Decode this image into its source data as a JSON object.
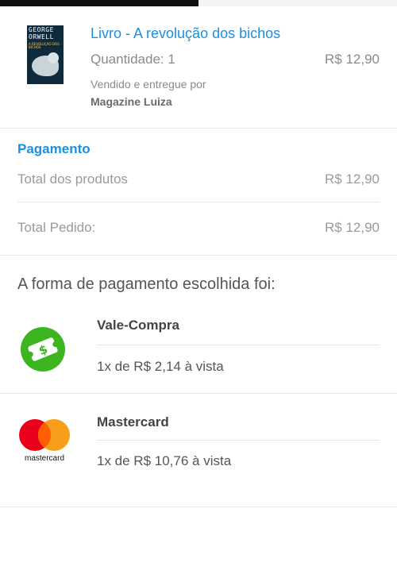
{
  "product": {
    "cover_line1": "GEORGE",
    "cover_line2": "ORWELL",
    "cover_line3": "A REVOLUÇÃO DOS BICHOS",
    "title": "Livro - A revolução dos bichos",
    "quantity": "Quantidade: 1",
    "price": "R$ 12,90",
    "sold_by": "Vendido e entregue por",
    "seller": "Magazine Luiza"
  },
  "payment": {
    "title": "Pagamento",
    "rows": [
      {
        "label": "Total dos produtos",
        "value": "R$ 12,90"
      },
      {
        "label": "Total Pedido:",
        "value": "R$ 12,90"
      }
    ]
  },
  "methods": {
    "heading": "A forma de pagamento escolhida foi:",
    "items": [
      {
        "name": "Vale-Compra",
        "detail": "1x de R$ 2,14 à vista",
        "icon": "voucher-icon"
      },
      {
        "name": "Mastercard",
        "detail": "1x de R$ 10,76 à vista",
        "icon": "mastercard-icon",
        "brand_text": "mastercard"
      }
    ]
  },
  "colors": {
    "accent": "#1a8fe3",
    "voucher_green": "#3cb521",
    "mastercard_red": "#eb001b",
    "mastercard_orange": "#f79e1b"
  }
}
